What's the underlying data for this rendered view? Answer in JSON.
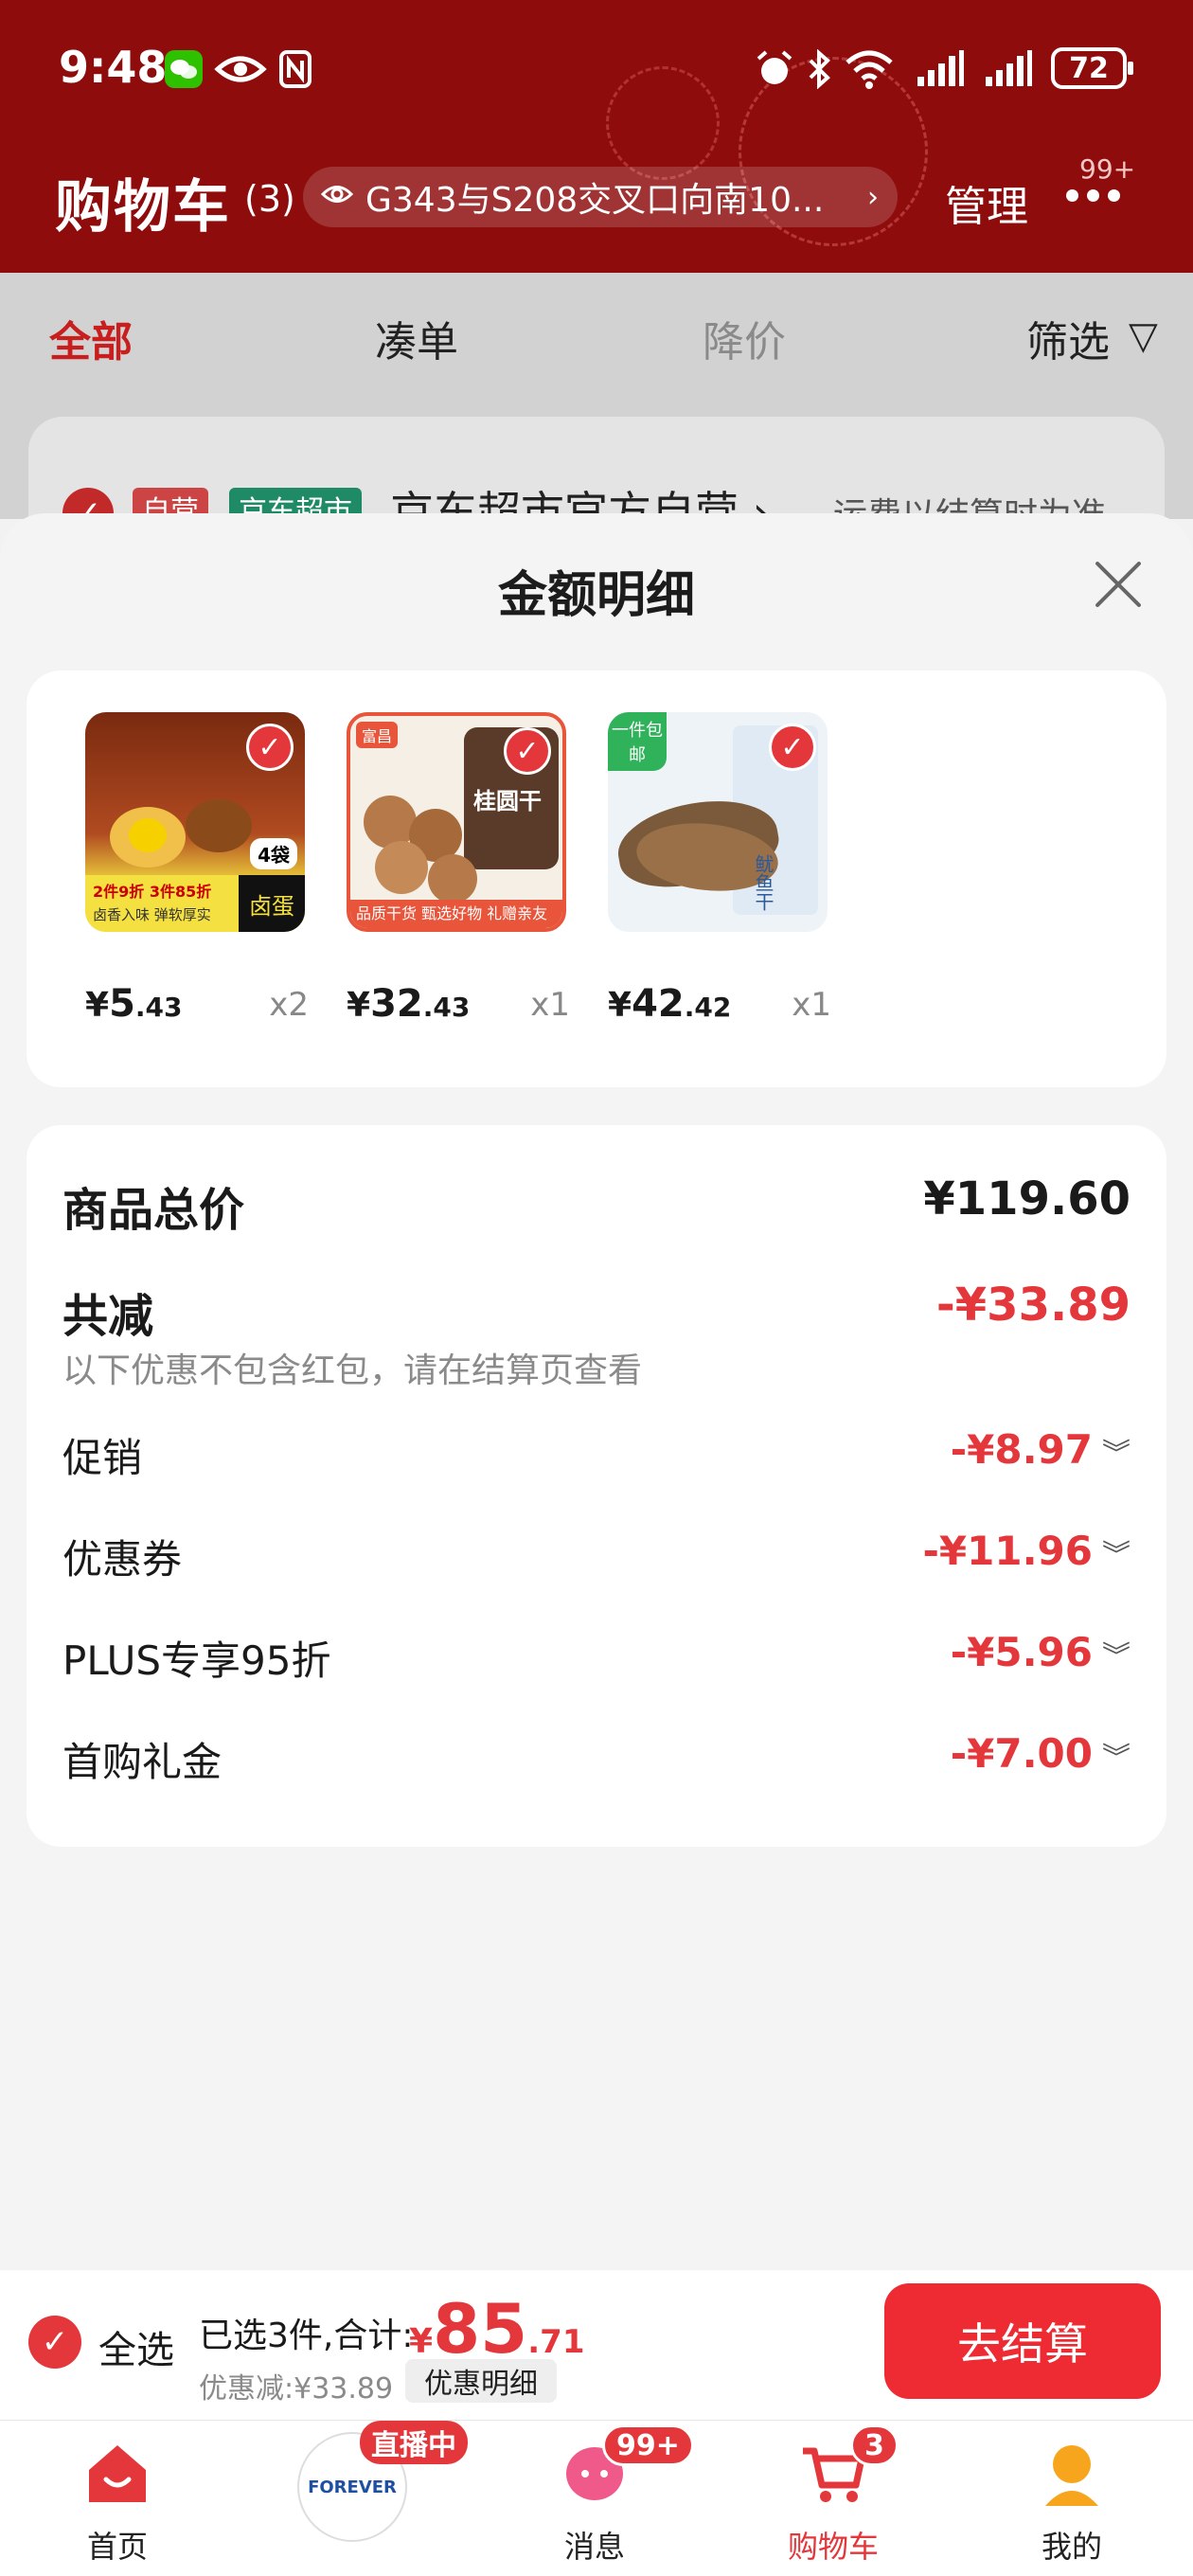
{
  "status_bar": {
    "time": "9:48",
    "battery": "72"
  },
  "header": {
    "title": "购物车",
    "count": "(3)",
    "address": "G343与S208交叉口向南10...",
    "manage_label": "管理",
    "more_badge": "99+"
  },
  "tabs": [
    {
      "label": "全部"
    },
    {
      "label": "凑单"
    },
    {
      "label": "降价"
    },
    {
      "label": "筛选"
    }
  ],
  "store": {
    "tag_self": "自营",
    "tag_market": "京东超市",
    "name": "京东超市官方自营 ›",
    "shipping_note": "运费以结算时为准"
  },
  "sheet": {
    "title": "金额明细",
    "products": [
      {
        "price_symbol": "¥",
        "price_int": "5",
        "price_cents": ".43",
        "qty": "x2",
        "thumb_text": "卤蛋",
        "thumb_tag": "4袋",
        "thumb_promo": "2件9折 3件85折",
        "thumb_note": "卤香入味 弹软厚实"
      },
      {
        "price_symbol": "¥",
        "price_int": "32",
        "price_cents": ".43",
        "qty": "x1",
        "thumb_text": "桂圆干",
        "thumb_promo": "品质干货 甄选好物 礼赠亲友",
        "thumb_tag": "富昌"
      },
      {
        "price_symbol": "¥",
        "price_int": "42",
        "price_cents": ".42",
        "qty": "x1",
        "thumb_text": "鱿鱼干",
        "thumb_tag": "一件包邮"
      }
    ],
    "summary": {
      "total_label": "商品总价",
      "total_value": "¥119.60",
      "reduce_label": "共减",
      "reduce_value": "-¥33.89",
      "reduce_note": "以下优惠不包含红包，请在结算页查看",
      "details": [
        {
          "label": "促销",
          "value": "-¥8.97"
        },
        {
          "label": "优惠券",
          "value": "-¥11.96"
        },
        {
          "label": "PLUS专享95折",
          "value": "-¥5.96"
        },
        {
          "label": "首购礼金",
          "value": "-¥7.00"
        }
      ]
    }
  },
  "checkout": {
    "select_all": "全选",
    "selected_text": "已选3件,合计:",
    "total_symbol": "¥",
    "total_int": "85",
    "total_cents": ".71",
    "discount_text": "优惠减:¥33.89",
    "detail_button": "优惠明细",
    "go_button": "去结算"
  },
  "nav": {
    "items": [
      {
        "label": "首页"
      },
      {
        "label": ""
      },
      {
        "label": "消息"
      },
      {
        "label": "购物车"
      },
      {
        "label": "我的"
      }
    ],
    "live_badge": "直播中",
    "message_badge": "99+",
    "cart_badge": "3",
    "brand_text": "FOREVER"
  },
  "colors": {
    "header_red": "#8e0c0c",
    "accent_red": "#e4373b",
    "checkout_button": "#ee2a33"
  }
}
